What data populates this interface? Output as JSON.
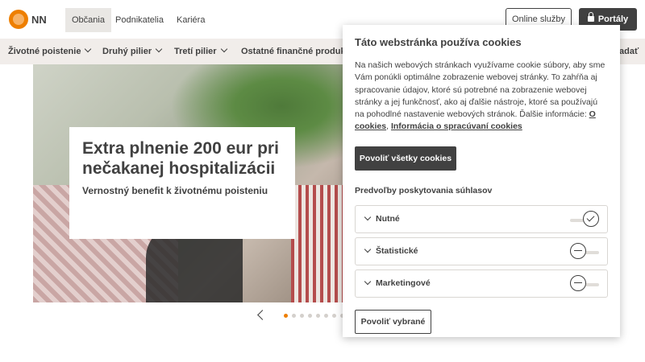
{
  "header": {
    "logo_text": "NN",
    "segments": [
      "Občania",
      "Podnikatelia",
      "Kariéra"
    ],
    "online_services": "Online služby",
    "portals": "Portály"
  },
  "nav": {
    "items": [
      "Životné poistenie",
      "Druhý pilier",
      "Tretí pilier",
      "Ostatné finančné produkty"
    ],
    "search_partial": "adať"
  },
  "hero": {
    "title": "Extra plnenie 200 eur pri nečakanej hospitalizácii",
    "subtitle": "Vernostný benefit k životnému poisteniu"
  },
  "carousel": {
    "active_index": 0,
    "dot_count": 8
  },
  "cookie": {
    "title": "Táto webstránka používa cookies",
    "text": "Na našich webových stránkach využívame cookie súbory, aby sme Vám ponúkli optimálne zobrazenie webovej stránky. To zahŕňa aj spracovanie údajov, ktoré sú potrebné na zobrazenie webovej stránky a jej funkčnosť, ako aj ďalšie nástroje, ktoré sa používajú na pohodlné nastavenie webových stránok. Ďalšie informácie: ",
    "link_cookies": "O cookies",
    "link_separator": ",",
    "link_data": "Informácia o spracúvaní cookies",
    "allow_all": "Povoliť všetky cookies",
    "preferences_heading": "Predvoľby poskytovania súhlasov",
    "categories": [
      {
        "label": "Nutné",
        "enabled": true
      },
      {
        "label": "Štatistické",
        "enabled": false
      },
      {
        "label": "Marketingové",
        "enabled": false
      }
    ],
    "save_selected": "Povoliť vybrané"
  }
}
